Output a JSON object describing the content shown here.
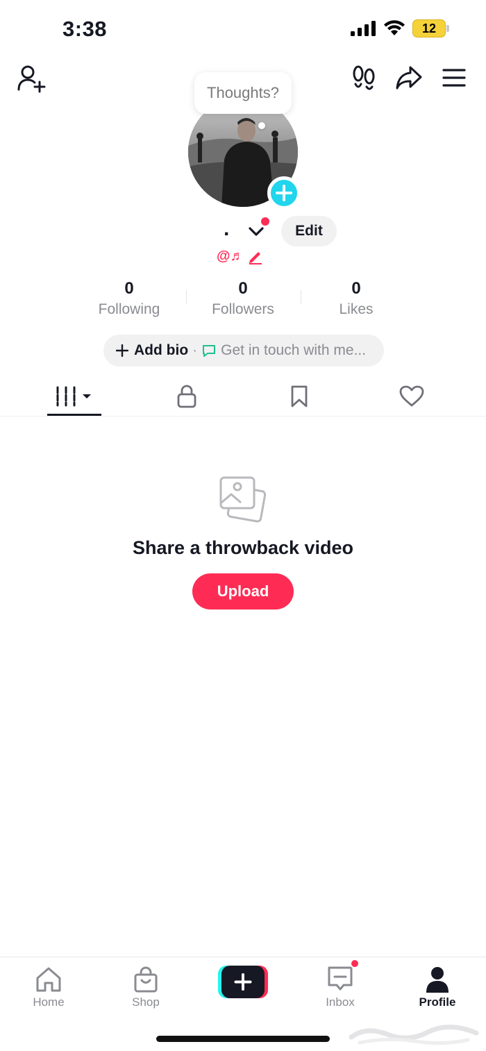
{
  "status_bar": {
    "time": "3:38",
    "battery_level": "12"
  },
  "thought_bubble": {
    "text": "Thoughts?"
  },
  "profile": {
    "name": ".",
    "edit_label": "Edit",
    "badges": "@♬"
  },
  "stats": [
    {
      "value": "0",
      "label": "Following"
    },
    {
      "value": "0",
      "label": "Followers"
    },
    {
      "value": "0",
      "label": "Likes"
    }
  ],
  "bio": {
    "add_label": "Add bio",
    "separator": "·",
    "contact_label": "Get in touch with me..."
  },
  "tabs": [
    {
      "name": "videos",
      "icon": "grid-icon",
      "active": true
    },
    {
      "name": "private",
      "icon": "lock-icon",
      "active": false
    },
    {
      "name": "favorites",
      "icon": "bookmark-icon",
      "active": false
    },
    {
      "name": "liked",
      "icon": "heart-icon",
      "active": false
    }
  ],
  "empty_state": {
    "title": "Share a throwback video",
    "button_label": "Upload"
  },
  "bottom_nav": [
    {
      "label": "Home",
      "icon": "home-icon",
      "active": false
    },
    {
      "label": "Shop",
      "icon": "shop-bag-icon",
      "active": false
    },
    {
      "label": "",
      "icon": "create-plus-icon",
      "active": false
    },
    {
      "label": "Inbox",
      "icon": "inbox-icon",
      "active": false
    },
    {
      "label": "Profile",
      "icon": "profile-icon",
      "active": true
    }
  ],
  "colors": {
    "accent": "#fe2c55",
    "cyan": "#20d5ec",
    "text_primary": "#161823",
    "text_secondary": "#8a8b91",
    "battery": "#f6d23a"
  }
}
